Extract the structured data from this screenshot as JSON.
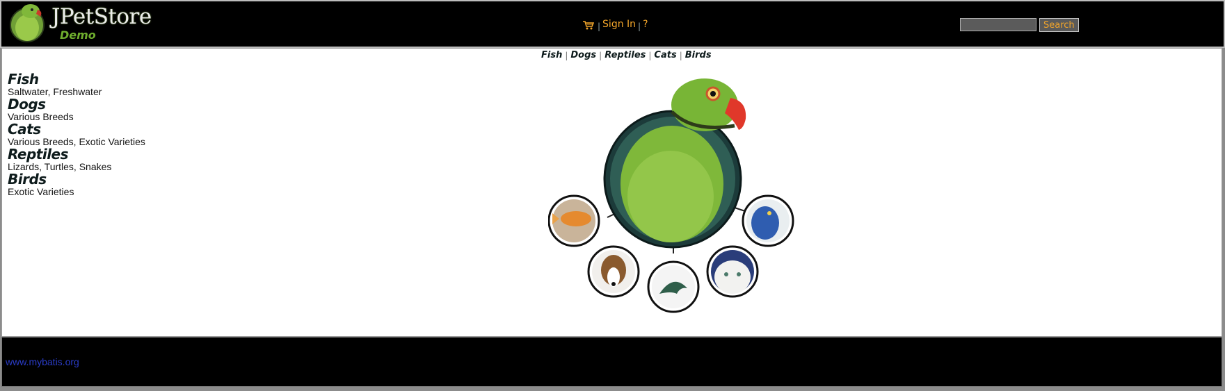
{
  "header": {
    "logo_title": "JPetStore",
    "logo_subtitle": "Demo",
    "cart_icon": "cart-icon",
    "sign_in": "Sign In",
    "help": "?",
    "search_value": "",
    "search_button": "Search"
  },
  "quick_links": [
    "Fish",
    "Dogs",
    "Reptiles",
    "Cats",
    "Birds"
  ],
  "sidebar": [
    {
      "title": "Fish",
      "desc": "Saltwater, Freshwater"
    },
    {
      "title": "Dogs",
      "desc": "Various Breeds"
    },
    {
      "title": "Cats",
      "desc": "Various Breeds, Exotic Varieties"
    },
    {
      "title": "Reptiles",
      "desc": "Lizards, Turtles, Snakes"
    },
    {
      "title": "Birds",
      "desc": "Exotic Varieties"
    }
  ],
  "footer": {
    "link": "www.mybatis.org"
  },
  "colors": {
    "header_bg": "#000000",
    "menu_link": "#f2a52a",
    "logo_green": "#6fae2e",
    "footer_link": "#2a3cc8"
  }
}
